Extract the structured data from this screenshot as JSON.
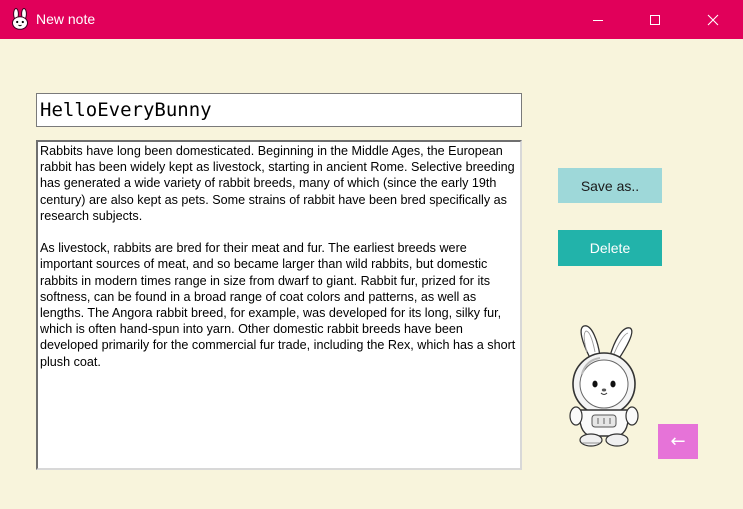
{
  "window": {
    "title": "New note",
    "app_icon": "bunny-icon",
    "controls": [
      "minimize-icon",
      "maximize-icon",
      "close-icon"
    ]
  },
  "note": {
    "title_value": "HelloEveryBunny",
    "body_value": "Rabbits have long been domesticated. Beginning in the Middle Ages, the European rabbit has been widely kept as livestock, starting in ancient Rome. Selective breeding has generated a wide variety of rabbit breeds, many of which (since the early 19th century) are also kept as pets. Some strains of rabbit have been bred specifically as research subjects.\n\nAs livestock, rabbits are bred for their meat and fur. The earliest breeds were important sources of meat, and so became larger than wild rabbits, but domestic rabbits in modern times range in size from dwarf to giant. Rabbit fur, prized for its softness, can be found in a broad range of coat colors and patterns, as well as lengths. The Angora rabbit breed, for example, was developed for its long, silky fur, which is often hand-spun into yarn. Other domestic rabbit breeds have been developed primarily for the commercial fur trade, including the Rex, which has a short plush coat."
  },
  "actions": {
    "save_label": "Save as..",
    "delete_label": "Delete",
    "back_label": "←"
  },
  "mascot": {
    "icon": "astronaut-bunny-illustration"
  },
  "colors": {
    "titlebar": "#e1005a",
    "background": "#f8f4dc",
    "save_button": "#9ed8d9",
    "delete_button": "#22b3aa",
    "back_button": "#e673d8"
  }
}
